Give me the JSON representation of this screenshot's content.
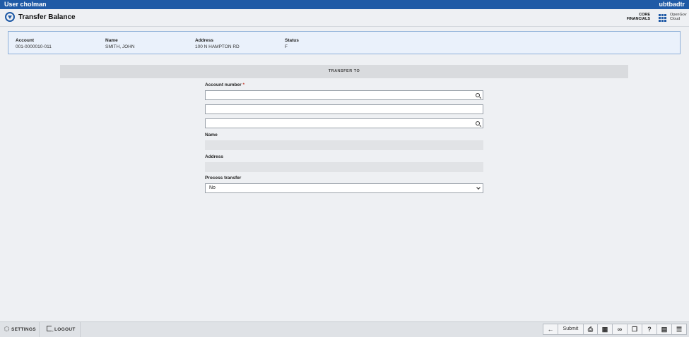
{
  "topbar": {
    "user": "User cholman",
    "code": "ubtbadtr"
  },
  "header": {
    "title": "Transfer Balance",
    "product_line1": "CORE",
    "product_line2": "FINANCIALS",
    "brand_line1": "OpenGov",
    "brand_line2": "Cloud"
  },
  "summary": {
    "account": {
      "label": "Account",
      "value": "001-0000010-011"
    },
    "name": {
      "label": "Name",
      "value": "SMITH, JOHN"
    },
    "address": {
      "label": "Address",
      "value": "100 N HAMPTON RD"
    },
    "status": {
      "label": "Status",
      "value": "F"
    }
  },
  "section": {
    "title": "TRANSFER TO"
  },
  "form": {
    "account_number_label": "Account number",
    "required_mark": "*",
    "account_number_value": "",
    "field2_value": "",
    "field3_value": "",
    "name_label": "Name",
    "name_value": "",
    "address_label": "Address",
    "address_value": "",
    "process_transfer_label": "Process transfer",
    "process_transfer_value": "No"
  },
  "footer": {
    "settings": "SETTINGS",
    "logout": "LOGOUT",
    "submit": "Submit"
  },
  "icons": [
    "search-icon",
    "chevron-down-icon",
    "gear-icon",
    "logout-icon",
    "back-arrow-icon",
    "print-icon",
    "grid-icon",
    "binoculars-icon",
    "windows-icon",
    "help-icon",
    "calendar-icon",
    "tree-icon",
    "apps-grid-icon"
  ],
  "colors": {
    "accent": "#1f5aa6",
    "required": "#c0392b"
  }
}
